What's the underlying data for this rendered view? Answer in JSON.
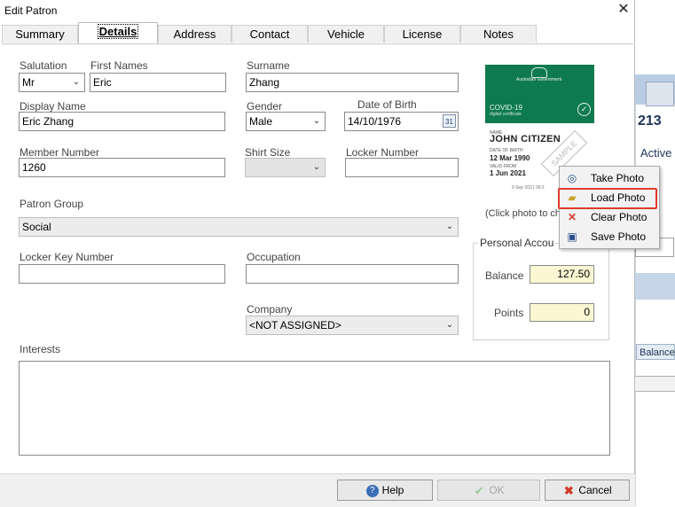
{
  "window": {
    "title": "Edit Patron",
    "close_glyph": "✕"
  },
  "tabs": [
    {
      "label": "Summary"
    },
    {
      "label": "Details"
    },
    {
      "label": "Address"
    },
    {
      "label": "Contact"
    },
    {
      "label": "Vehicle"
    },
    {
      "label": "License"
    },
    {
      "label": "Notes"
    }
  ],
  "form": {
    "salutation": {
      "label": "Salutation",
      "value": "Mr"
    },
    "first_names": {
      "label": "First Names",
      "value": "Eric"
    },
    "surname": {
      "label": "Surname",
      "value": "Zhang"
    },
    "display_name": {
      "label": "Display Name",
      "value": "Eric Zhang"
    },
    "gender": {
      "label": "Gender",
      "value": "Male"
    },
    "date_of_birth": {
      "label": "Date of Birth",
      "value": "14/10/1976",
      "calendar_text": "31"
    },
    "member_number": {
      "label": "Member Number",
      "value": "1260"
    },
    "shirt_size": {
      "label": "Shirt Size",
      "value": ""
    },
    "locker_number": {
      "label": "Locker Number",
      "value": ""
    },
    "patron_group": {
      "label": "Patron Group",
      "value": "Social"
    },
    "locker_key_number": {
      "label": "Locker Key Number",
      "value": ""
    },
    "occupation": {
      "label": "Occupation",
      "value": ""
    },
    "company": {
      "label": "Company",
      "value": "<NOT ASSIGNED>"
    },
    "interests": {
      "label": "Interests",
      "value": ""
    }
  },
  "photo": {
    "cert_gov": "Australian Government",
    "cert_title": "COVID-19",
    "cert_subtitle": "digital certificate",
    "name_caption": "NAME",
    "name": "JOHN CITIZEN",
    "dob_caption": "DATE OF BIRTH",
    "dob": "12 Mar 1990",
    "valid_caption": "VALID FROM",
    "valid": "1 Jun 2021",
    "footer": "9 Sep 2021 09:2",
    "stamp": "SAMPLE",
    "hint": "(Click photo to cha"
  },
  "personal_account": {
    "title": "Personal Accou",
    "balance_label": "Balance",
    "balance_value": "127.50",
    "points_label": "Points",
    "points_value": "0"
  },
  "context_menu": {
    "items": [
      {
        "label": "Take Photo",
        "icon": "camera-icon"
      },
      {
        "label": "Load Photo",
        "icon": "folder-open-icon"
      },
      {
        "label": "Clear Photo",
        "icon": "red-x-icon"
      },
      {
        "label": "Save Photo",
        "icon": "floppy-disk-icon"
      }
    ],
    "highlighted_index": 1
  },
  "buttons": {
    "help": "Help",
    "ok": "OK",
    "cancel": "Cancel"
  },
  "background_app": {
    "number": "213",
    "status": "Active",
    "balance_label": "Balance"
  },
  "colors": {
    "cert_green": "#0f7a4f",
    "account_field_bg": "#fbf7d3",
    "highlight_red": "#e03a2c"
  }
}
